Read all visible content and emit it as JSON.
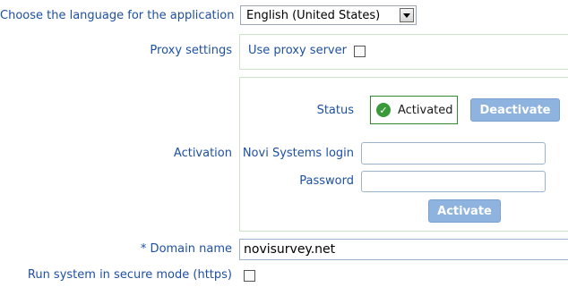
{
  "language": {
    "label": "Choose the language for the application",
    "selected": "English (United States)"
  },
  "proxy": {
    "label": "Proxy settings",
    "checkbox_label": "Use proxy server",
    "checked": false
  },
  "activation": {
    "label": "Activation",
    "status_label": "Status",
    "status_value": "Activated",
    "deactivate_button": "Deactivate",
    "login_label": "Novi Systems login",
    "login_value": "",
    "password_label": "Password",
    "password_value": "",
    "activate_button": "Activate"
  },
  "domain": {
    "label": "* Domain name",
    "value": "novisurvey.net"
  },
  "secure_mode": {
    "label": "Run system in secure mode (https)",
    "checked": false
  },
  "colors": {
    "label_text": "#1e50a2",
    "panel_border": "#cfe3c7",
    "status_border": "#2e8b2e",
    "button_bg": "#8fb3df"
  }
}
